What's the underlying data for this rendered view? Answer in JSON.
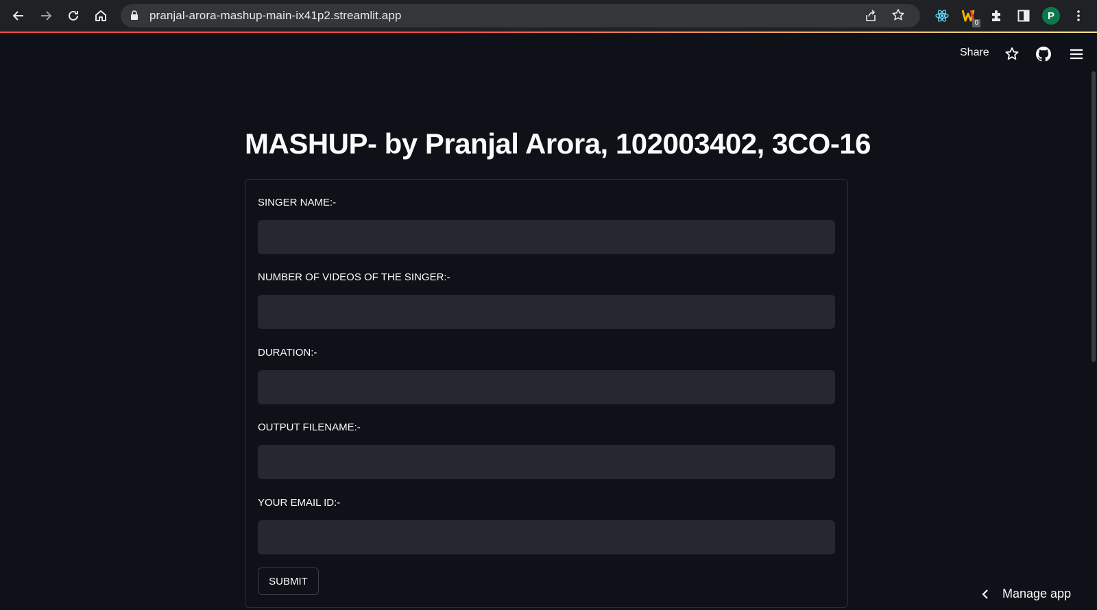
{
  "browser": {
    "url": "pranjal-arora-mashup-main-ix41p2.streamlit.app",
    "profile_initial": "P",
    "extension_badge": "0",
    "accent_gradient": [
      "#ff4b4b",
      "#ffb36b",
      "#fde68a"
    ],
    "icons": [
      "back-arrow-icon",
      "forward-arrow-icon",
      "reload-icon",
      "home-icon",
      "lock-icon",
      "share-page-icon",
      "bookmark-star-icon",
      "react-devtools-icon",
      "extension-w-icon",
      "extensions-puzzle-icon",
      "side-panel-icon",
      "kebab-menu-icon"
    ]
  },
  "header": {
    "share_label": "Share",
    "icons": [
      "star-icon",
      "github-icon",
      "hamburger-menu-icon"
    ]
  },
  "main": {
    "title": "MASHUP- by Pranjal Arora, 102003402, 3CO-16",
    "fields": [
      {
        "label": "SINGER NAME:-",
        "value": ""
      },
      {
        "label": "NUMBER OF VIDEOS OF THE SINGER:-",
        "value": ""
      },
      {
        "label": "DURATION:-",
        "value": ""
      },
      {
        "label": "OUTPUT FILENAME:-",
        "value": ""
      },
      {
        "label": "YOUR EMAIL ID:-",
        "value": ""
      }
    ],
    "submit_label": "SUBMIT"
  },
  "footer": {
    "manage_app_label": "Manage app"
  },
  "colors": {
    "background": "#0e1117",
    "input_background": "#262730",
    "text": "#fafafa",
    "chrome_toolbar": "#202124",
    "omnibox": "#35363a"
  }
}
